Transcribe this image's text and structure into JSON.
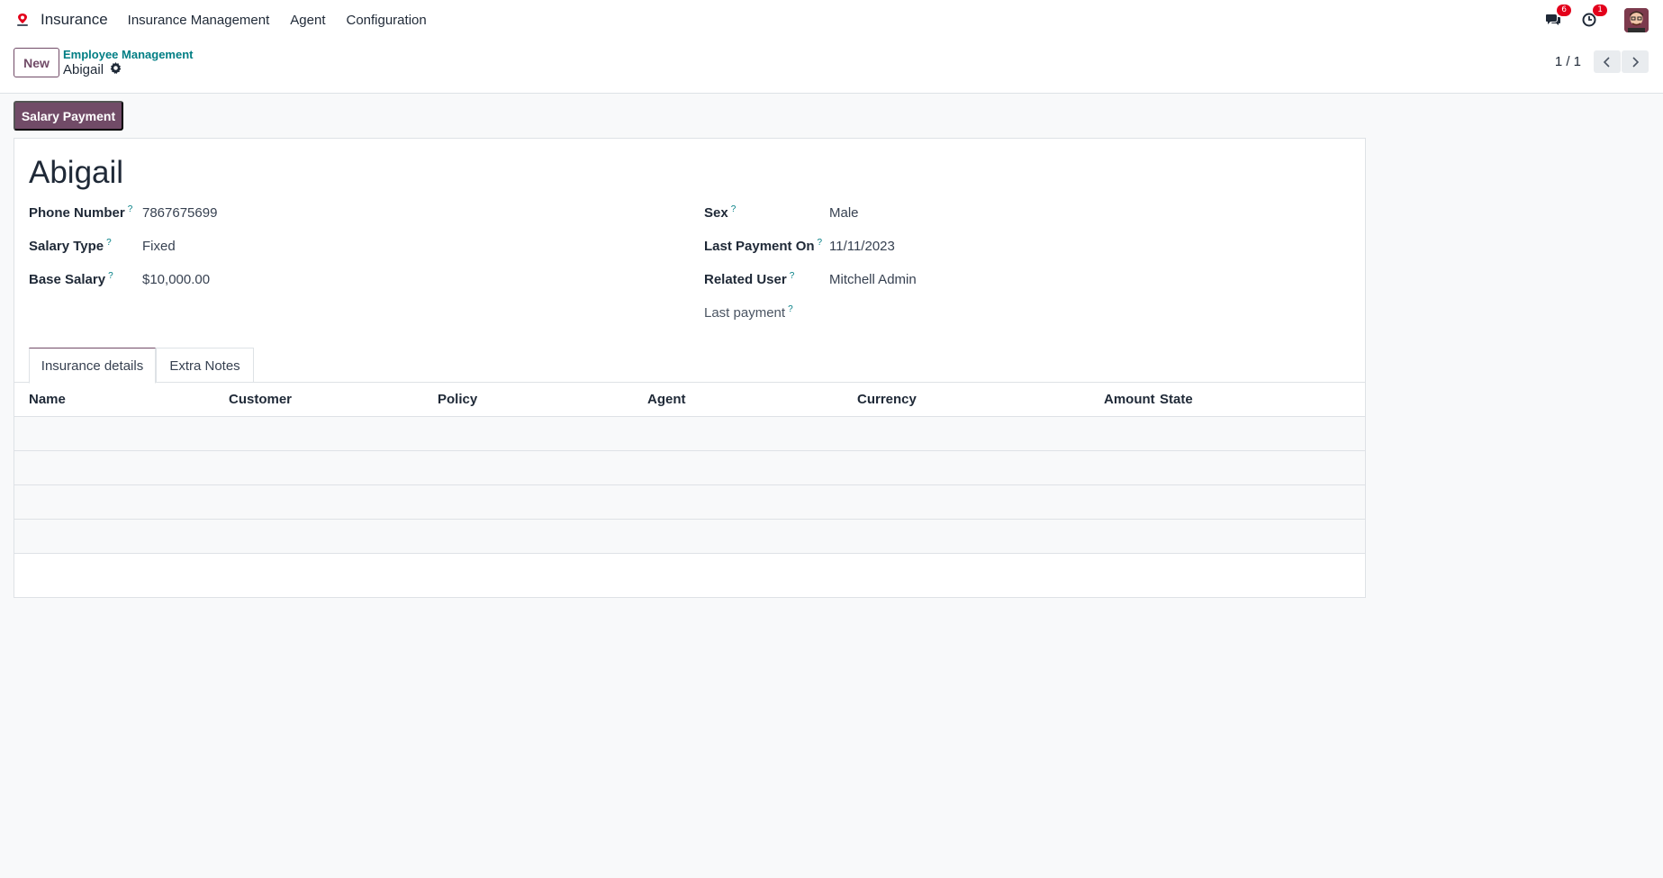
{
  "navbar": {
    "app_name": "Insurance",
    "menu": [
      "Insurance Management",
      "Agent",
      "Configuration"
    ],
    "messages_badge": "6",
    "activities_badge": "1"
  },
  "control_panel": {
    "new_label": "New",
    "breadcrumb": "Employee Management",
    "record_name": "Abigail",
    "pager": "1 / 1"
  },
  "actions": {
    "salary_payment_label": "Salary Payment"
  },
  "form": {
    "title": "Abigail",
    "left_fields": [
      {
        "label": "Phone Number",
        "value": "7867675699"
      },
      {
        "label": "Salary Type",
        "value": "Fixed"
      },
      {
        "label": "Base Salary",
        "value": "$10,000.00"
      }
    ],
    "right_fields": [
      {
        "label": "Sex",
        "value": "Male"
      },
      {
        "label": "Last Payment On",
        "value": "11/11/2023"
      },
      {
        "label": "Related User",
        "value": "Mitchell Admin"
      },
      {
        "label": "Last payment",
        "value": ""
      }
    ],
    "help_mark": "?"
  },
  "tabs": [
    "Insurance details",
    "Extra Notes"
  ],
  "table": {
    "columns": [
      "Name",
      "Customer",
      "Policy",
      "Agent",
      "Currency",
      "Amount",
      "State"
    ]
  },
  "colors": {
    "primary": "#714b67",
    "link": "#017e84",
    "badge": "#e3001b"
  }
}
